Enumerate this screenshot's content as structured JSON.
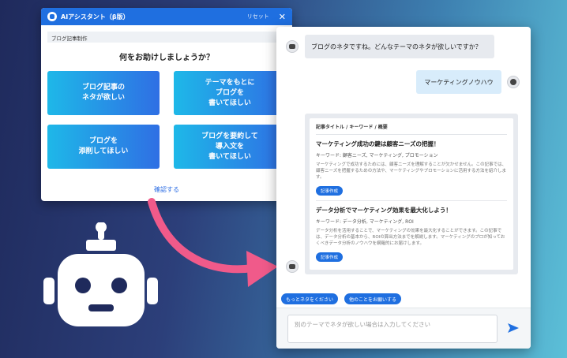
{
  "assistant": {
    "title": "AIアシスタント（β版）",
    "reset_label": "リセット",
    "close_icon": "close-icon",
    "section_label": "ブログ記事制作",
    "question": "何をお助けしましょうか？",
    "options": [
      "ブログ記事の\nネタが欲しい",
      "テーマをもとに\nブログを\n書いてほしい",
      "ブログを\n添削してほしい",
      "ブログを要約して\n導入文を\n書いてほしい"
    ],
    "confirm_label": "確認する"
  },
  "chat": {
    "bot_message": "ブログのネタですね。どんなテーマのネタが欲しいですか？",
    "user_message": "マーケティングノウハウ",
    "result_header": "記事タイトル / キーワード / 概要",
    "articles": [
      {
        "title": "マーケティング成功の鍵は顧客ニーズの把握！",
        "keywords": "キーワード: 顧客ニーズ, マーケティング, プロモーション",
        "description": "マーケティングで成功するためには、顧客ニーズを理解することが欠かせません。この記事では、顧客ニーズを把握するための方法や、マーケティングやプロモーションに活用する方法を紹介します。",
        "button": "記事作成"
      },
      {
        "title": "データ分析でマーケティング効果を最大化しよう！",
        "keywords": "キーワード: データ分析, マーケティング, ROI",
        "description": "データ分析を活用することで、マーケティングの効果を最大化することができます。この記事では、データ分析の基本から、ROIの算出方法までを解説します。マーケティングのプロが知っておくべきデータ分析のノウハウを網羅的にお届けします。",
        "button": "記事作成"
      }
    ],
    "chips": [
      "もっとネタをください",
      "他のことをお願いする"
    ],
    "input_placeholder": "別のテーマでネタが欲しい場合は入力してください",
    "send_icon": "send-icon"
  },
  "colors": {
    "accent": "#1f6fe0",
    "arrow": "#f05a8a"
  }
}
